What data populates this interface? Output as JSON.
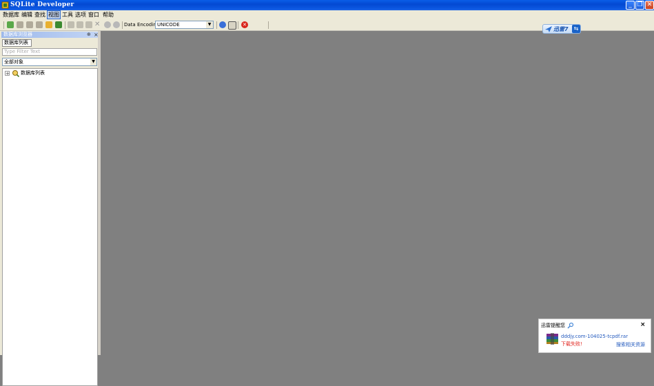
{
  "window": {
    "title": "SQLite Developer",
    "minimize": "_",
    "restore": "❐",
    "close": "✕"
  },
  "menu": [
    "数据库",
    "编辑",
    "查找",
    "视图",
    "工具",
    "选项",
    "窗口",
    "帮助"
  ],
  "toolbar": {
    "encoding_label": "Data Encoding:",
    "encoding_value": "UNICODE"
  },
  "panel": {
    "title": "数据库浏览器",
    "pin": "⊕",
    "close": "×",
    "tab": "数据库列表",
    "filter_placeholder": "Type Filter Text",
    "object_filter": "全部对象",
    "tree_expand": "+",
    "tree_root": "数据库列表"
  },
  "xunlei_badge": {
    "label": "迅雷7",
    "icon": "plane-icon"
  },
  "notification": {
    "title": "迅雷提醒您",
    "close": "×",
    "file": "dddjy.com-104025-tcpdf.rar",
    "status": "下载失败!",
    "action": "搜索相关资源"
  },
  "colors": {
    "titlebar": "#0349d2",
    "workspace": "#808080",
    "panel_bg": "#ece9d8",
    "error": "#e0201a",
    "link": "#2158bd"
  }
}
